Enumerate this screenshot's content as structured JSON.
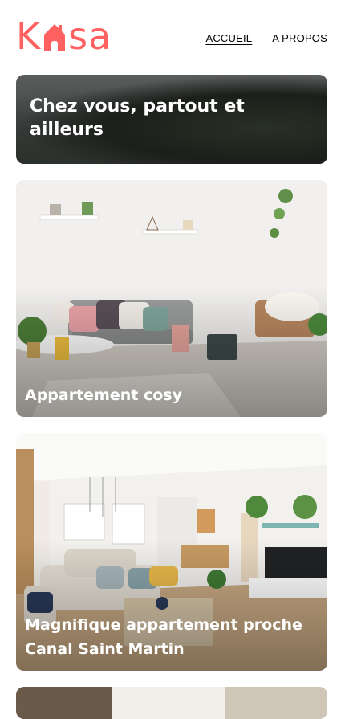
{
  "header": {
    "logo": {
      "prefix": "K",
      "suffix": "sa",
      "icon": "house-icon",
      "color": "#ff6060"
    },
    "nav": [
      {
        "label": "ACCUEIL",
        "active": true
      },
      {
        "label": "A PROPOS",
        "active": false
      }
    ]
  },
  "banner": {
    "title": "Chez vous, partout et ailleurs"
  },
  "listings": [
    {
      "title": "Appartement cosy"
    },
    {
      "title": "Magnifique appartement proche Canal Saint Martin"
    },
    {
      "title": ""
    }
  ],
  "colors": {
    "accent": "#ff6060",
    "text": "#000000",
    "card_text": "#ffffff"
  }
}
